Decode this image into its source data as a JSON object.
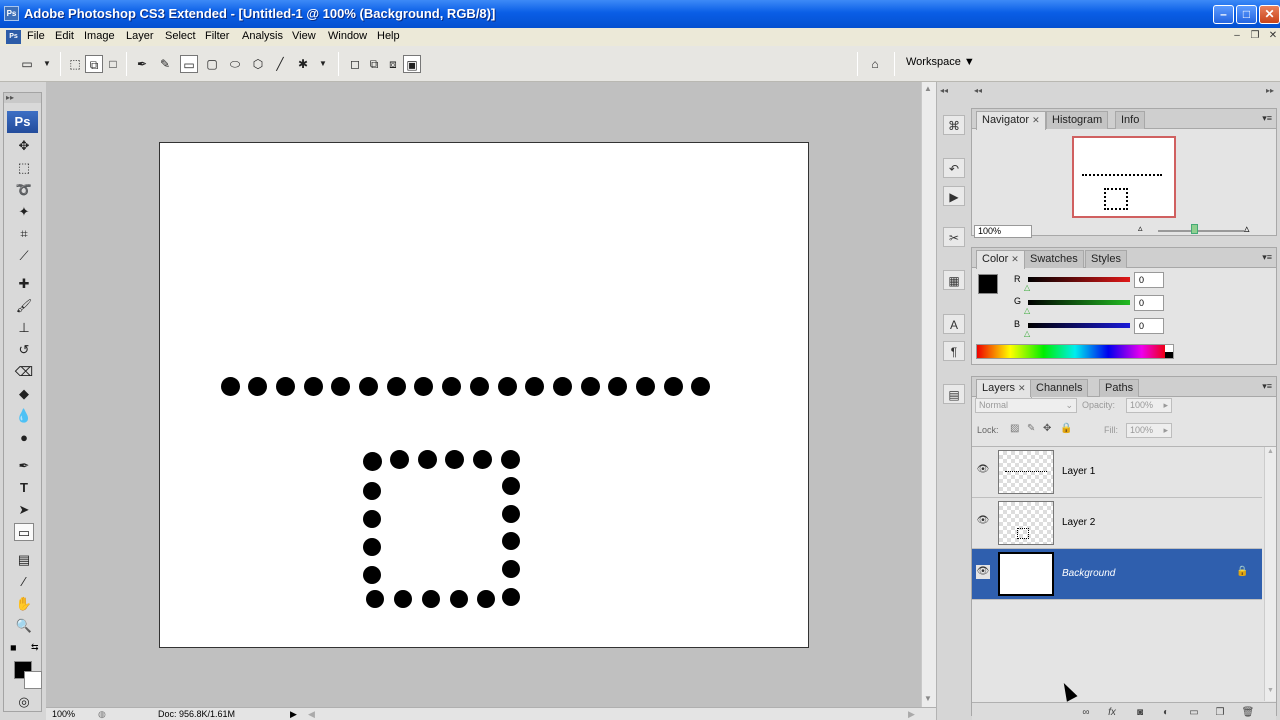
{
  "window": {
    "app_icon": "Ps",
    "title": "Adobe Photoshop CS3 Extended - [Untitled-1 @ 100% (Background, RGB/8)]",
    "controls": {
      "minimize": "–",
      "maximize": "□",
      "close": "✕"
    }
  },
  "menubar": {
    "doc_icon": "Ps",
    "items": [
      "File",
      "Edit",
      "Image",
      "Layer",
      "Select",
      "Filter",
      "Analysis",
      "View",
      "Window",
      "Help"
    ],
    "mdi": {
      "minimize": "–",
      "restore": "❐",
      "close": "✕"
    }
  },
  "options_bar": {
    "icons": [
      "marquee-preset-icon",
      "dropdown-icon",
      "shape-layers-icon",
      "paths-icon",
      "fill-pixels-icon",
      "pen-icon",
      "freeform-pen-icon",
      "rectangle-icon",
      "rounded-rectangle-icon",
      "ellipse-icon",
      "polygon-icon",
      "line-icon",
      "custom-shape-icon",
      "dropdown-icon",
      "new-area-icon",
      "add-area-icon",
      "subtract-area-icon",
      "intersect-area-icon",
      "exclude-area-icon"
    ],
    "workspace_label": "Workspace ▼"
  },
  "toolbox": {
    "grip": "▸▸",
    "logo": "Ps",
    "tools": [
      "move-icon",
      "marquee-icon",
      "lasso-icon",
      "magic-wand-icon",
      "crop-icon",
      "slice-icon",
      "healing-brush-icon",
      "brush-icon",
      "clone-stamp-icon",
      "history-brush-icon",
      "eraser-icon",
      "paint-bucket-icon",
      "blur-icon",
      "dodge-icon",
      "pen-tool-icon",
      "type-icon",
      "path-selection-icon",
      "shape-tool-icon",
      "notes-icon",
      "eyedropper-icon",
      "hand-icon",
      "zoom-icon"
    ],
    "type_glyph": "T"
  },
  "status": {
    "zoom": "100%",
    "doc": "Doc: 956.8K/1.61M"
  },
  "navigator_panel": {
    "tabs": [
      "Navigator",
      "Histogram",
      "Info"
    ],
    "zoom": "100%"
  },
  "color_panel": {
    "tabs": [
      "Color",
      "Swatches",
      "Styles"
    ],
    "channels": [
      {
        "label": "R",
        "value": "0",
        "color": "#e01818"
      },
      {
        "label": "G",
        "value": "0",
        "color": "#22bb22"
      },
      {
        "label": "B",
        "value": "0",
        "color": "#1a1ad8"
      }
    ]
  },
  "layers_panel": {
    "tabs": [
      "Layers",
      "Channels",
      "Paths"
    ],
    "blend_mode": "Normal",
    "opacity_label": "Opacity:",
    "opacity_value": "100%",
    "lock_label": "Lock:",
    "fill_label": "Fill:",
    "fill_value": "100%",
    "layers": [
      {
        "name": "Layer 1",
        "selected": false
      },
      {
        "name": "Layer 2",
        "selected": false
      },
      {
        "name": "Background",
        "selected": true
      }
    ]
  },
  "accent_color": "#2f5fae"
}
